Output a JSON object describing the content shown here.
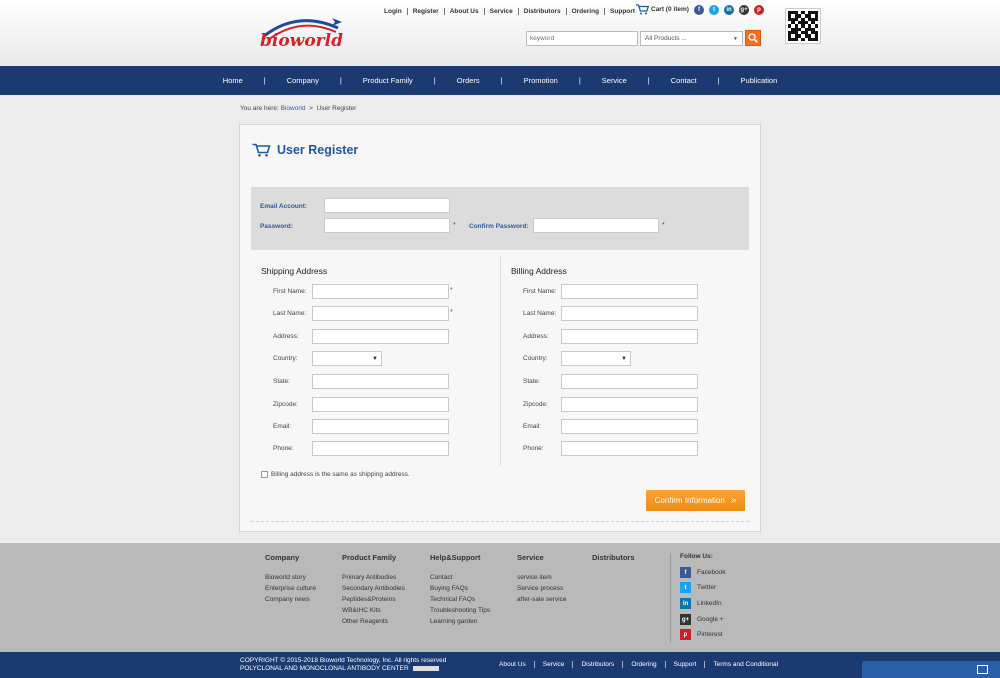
{
  "header": {
    "logo_text": "bioworld",
    "toplinks": [
      "Login",
      "Register",
      "About Us",
      "Service",
      "Distributors",
      "Ordering",
      "Support"
    ],
    "cart_label": "Cart (0 item)",
    "socials": [
      {
        "name": "facebook-icon",
        "glyph": "f",
        "color": "#3b5998"
      },
      {
        "name": "twitter-icon",
        "glyph": "t",
        "color": "#1da1f2"
      },
      {
        "name": "linkedin-icon",
        "glyph": "in",
        "color": "#0e76a8"
      },
      {
        "name": "google-plus-icon",
        "glyph": "g+",
        "color": "#333333"
      },
      {
        "name": "pinterest-icon",
        "glyph": "p",
        "color": "#cb2027"
      }
    ],
    "search_placeholder": "keyword",
    "category_selected": "All Products ..."
  },
  "nav": [
    "Home",
    "Company",
    "Product Family",
    "Orders",
    "Promotion",
    "Service",
    "Contact",
    "Publication"
  ],
  "breadcrumb": {
    "prefix": "You are here:",
    "link": "Bioworld",
    "current": "User Register"
  },
  "form": {
    "title": "User Register",
    "email_label": "Email Account:",
    "password_label": "Password:",
    "confirm_password_label": "Confirm Password:",
    "required_mark": "*",
    "shipping_title": "Shipping Address",
    "billing_title": "Billing Address",
    "fields": [
      "First Name:",
      "Last Name:",
      "Address:",
      "Country:",
      "State:",
      "Zipcode:",
      "Email:",
      "Phone:"
    ],
    "same_address_label": "Billing address is the same as shipping address.",
    "confirm_button": "Confirm Information"
  },
  "footer": {
    "columns": [
      {
        "heading": "Company",
        "links": [
          "Bioworld story",
          "Enterprise culture",
          "Company news"
        ]
      },
      {
        "heading": "Product Family",
        "links": [
          "Primary Antibodies",
          "Secondary Antibodies",
          "Peptides&Proteins",
          "WB&IHC Kits",
          "Other Reagents"
        ]
      },
      {
        "heading": "Help&Support",
        "links": [
          "Contact",
          "Buying FAQs",
          "Technical FAQs",
          "Troubleshooting Tips",
          "Learning garden"
        ]
      },
      {
        "heading": "Service",
        "links": [
          "service item",
          "Service process",
          "after-sale service"
        ]
      },
      {
        "heading": "Distributors",
        "links": []
      }
    ],
    "follow_title": "Follow Us:",
    "follow": [
      {
        "label": "Facebook",
        "glyph": "f",
        "color": "#3b5998"
      },
      {
        "label": "Twitter",
        "glyph": "t",
        "color": "#1da1f2"
      },
      {
        "label": "LinkedIn",
        "glyph": "in",
        "color": "#0e76a8"
      },
      {
        "label": "Google +",
        "glyph": "g+",
        "color": "#333333"
      },
      {
        "label": "Pinterest",
        "glyph": "p",
        "color": "#cb2027"
      }
    ]
  },
  "bottom": {
    "copyright_line1": "COPYRIGHT © 2015-2018 Bioworld Technology, Inc. All rights reserved",
    "copyright_line2": "POLYCLONAL AND MONOCLONAL ANTIBODY CENTER",
    "links": [
      "About Us",
      "Service",
      "Distributors",
      "Ordering",
      "Support",
      "Terms and Conditional"
    ]
  },
  "colors": {
    "brand_navy": "#1b3a6f",
    "accent_orange": "#f39012",
    "link_blue": "#1f5aa0"
  }
}
